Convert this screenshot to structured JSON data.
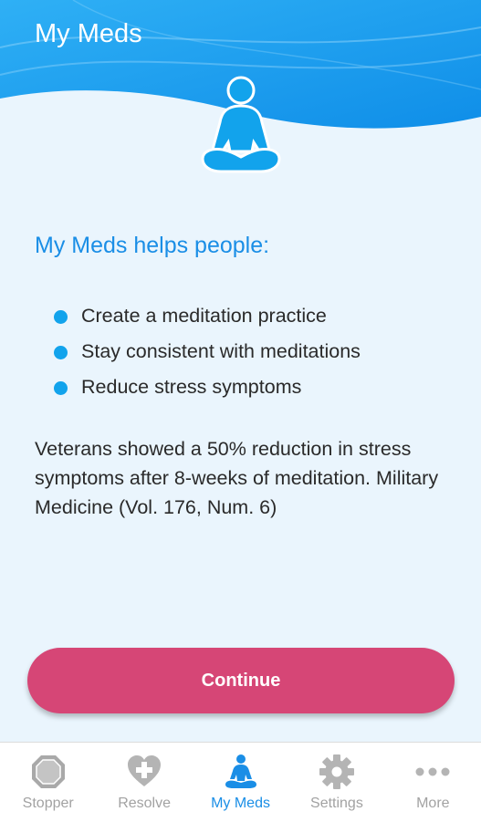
{
  "colors": {
    "header_blue": "#1a9ff0",
    "accent_blue": "#1a8ee6",
    "icon_blue": "#12a3ec",
    "button_pink": "#d64676",
    "background": "#eaf5fd",
    "nav_inactive": "#a2a2a2"
  },
  "header": {
    "title": "My Meds",
    "hero_icon": "meditation-figure-icon"
  },
  "main": {
    "heading": "My Meds helps people:",
    "bullets": [
      "Create a meditation practice",
      "Stay consistent with meditations",
      "Reduce stress symptoms"
    ],
    "study_text": "Veterans showed a 50% reduction in stress symptoms after 8-weeks of meditation. Military Medicine (Vol. 176, Num. 6)"
  },
  "actions": {
    "continue_label": "Continue"
  },
  "bottom_nav": {
    "items": [
      {
        "label": "Stopper",
        "icon": "stop-octagon-icon",
        "active": false
      },
      {
        "label": "Resolve",
        "icon": "heart-plus-icon",
        "active": false
      },
      {
        "label": "My Meds",
        "icon": "meditation-icon",
        "active": true
      },
      {
        "label": "Settings",
        "icon": "gear-icon",
        "active": false
      },
      {
        "label": "More",
        "icon": "more-dots-icon",
        "active": false
      }
    ]
  }
}
